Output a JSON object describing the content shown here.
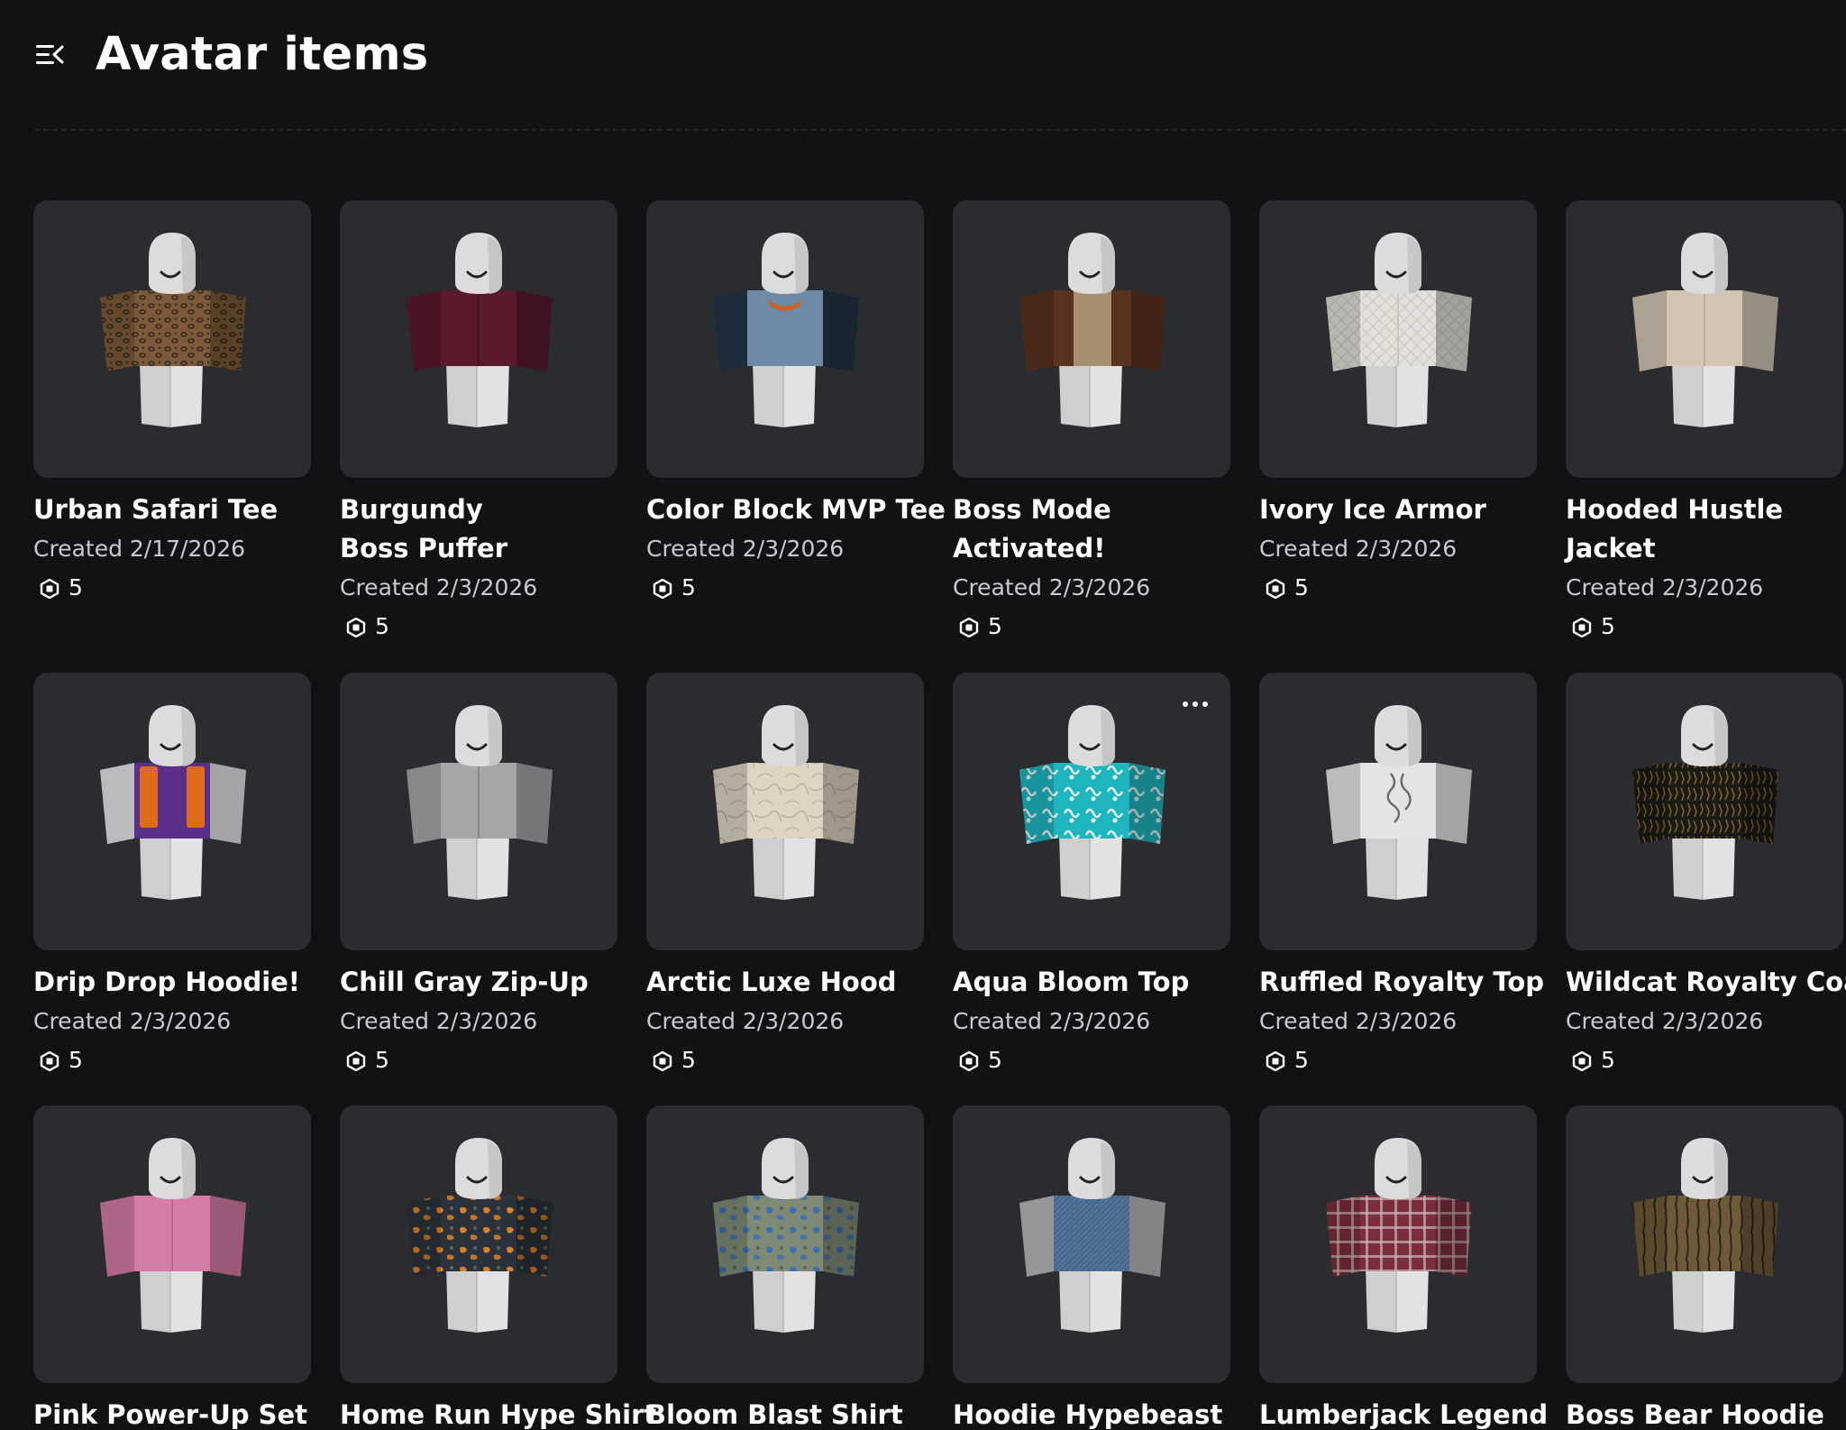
{
  "header": {
    "title": "Avatar items",
    "menu_icon": "menu-collapse-icon"
  },
  "colors": {
    "background": "#121214",
    "card": "#2b2c30",
    "text": "#ffffff",
    "muted": "#c9cacd"
  },
  "items": [
    {
      "name": "Urban Safari Tee",
      "created": "Created 2/17/2026",
      "price": "5",
      "shirt": "leopard",
      "c1": "#7a5a3a",
      "c2": "#3a2a1c"
    },
    {
      "name": "Burgundy Boss Puffer",
      "created": "Created 2/3/2026",
      "price": "5",
      "shirt": "solid",
      "c1": "#5a1a2c",
      "c2": "#40111f"
    },
    {
      "name": "Color Block MVP Tee",
      "created": "Created 2/3/2026",
      "price": "5",
      "shirt": "colorblock",
      "c1": "#6f8aa6",
      "c2": "#243446"
    },
    {
      "name": "Boss Mode Activated!",
      "created": "Created 2/3/2026",
      "price": "5",
      "shirt": "jacket",
      "c1": "#5a3320",
      "c2": "#a88e70"
    },
    {
      "name": "Ivory Ice Armor",
      "created": "Created 2/3/2026",
      "price": "5",
      "shirt": "quilt",
      "c1": "#e2e0da",
      "c2": "#c8c6bf"
    },
    {
      "name": "Hooded Hustle Jacket",
      "created": "Created 2/3/2026",
      "price": "5",
      "shirt": "solid",
      "c1": "#d2c5b4",
      "c2": "#bcae9b"
    },
    {
      "name": "Drip Drop Hoodie!",
      "created": "Created 2/3/2026",
      "price": "5",
      "shirt": "drip",
      "c1": "#5a2f8a",
      "c2": "#e06a1c"
    },
    {
      "name": "Chill Gray Zip-Up",
      "created": "Created 2/3/2026",
      "price": "5",
      "shirt": "solid",
      "c1": "#a6a6a8",
      "c2": "#8a8a8c"
    },
    {
      "name": "Arctic Luxe Hood",
      "created": "Created 2/3/2026",
      "price": "5",
      "shirt": "marble",
      "c1": "#ddd4c2",
      "c2": "#b8ad98"
    },
    {
      "name": "Aqua Bloom Top",
      "created": "Created 2/3/2026",
      "price": "5",
      "shirt": "floral",
      "c1": "#1fb5bf",
      "c2": "#e8f4f4"
    },
    {
      "name": "Ruffled Royalty Top",
      "created": "Created 2/3/2026",
      "price": "5",
      "shirt": "ruffle",
      "c1": "#e4e4e4",
      "c2": "#6a6a6a"
    },
    {
      "name": "Wildcat Royalty Coat",
      "created": "Created 2/3/2026",
      "price": "5",
      "shirt": "goldblack",
      "c1": "#1c1a16",
      "c2": "#8a6a2a"
    },
    {
      "name": "Pink Power-Up Set",
      "created": "",
      "price": "",
      "shirt": "solid",
      "c1": "#d47ca6",
      "c2": "#bd6690"
    },
    {
      "name": "Home Run Hype Shirt",
      "created": "",
      "price": "",
      "shirt": "camo",
      "c1": "#2c323c",
      "c2": "#d9822a"
    },
    {
      "name": "Bloom Blast Shirt",
      "created": "",
      "price": "",
      "shirt": "camo",
      "c1": "#7e8a76",
      "c2": "#3d6fb0"
    },
    {
      "name": "Hoodie Hypebeast",
      "created": "",
      "price": "",
      "shirt": "denim",
      "c1": "#47688c",
      "c2": "#b8b8b8"
    },
    {
      "name": "Lumberjack Legend",
      "created": "",
      "price": "",
      "shirt": "plaid",
      "c1": "#7a2e3c",
      "c2": "#c9b6b6"
    },
    {
      "name": "Boss Bear Hoodie",
      "created": "",
      "price": "",
      "shirt": "bark",
      "c1": "#6e5a3a",
      "c2": "#2e2416"
    }
  ]
}
